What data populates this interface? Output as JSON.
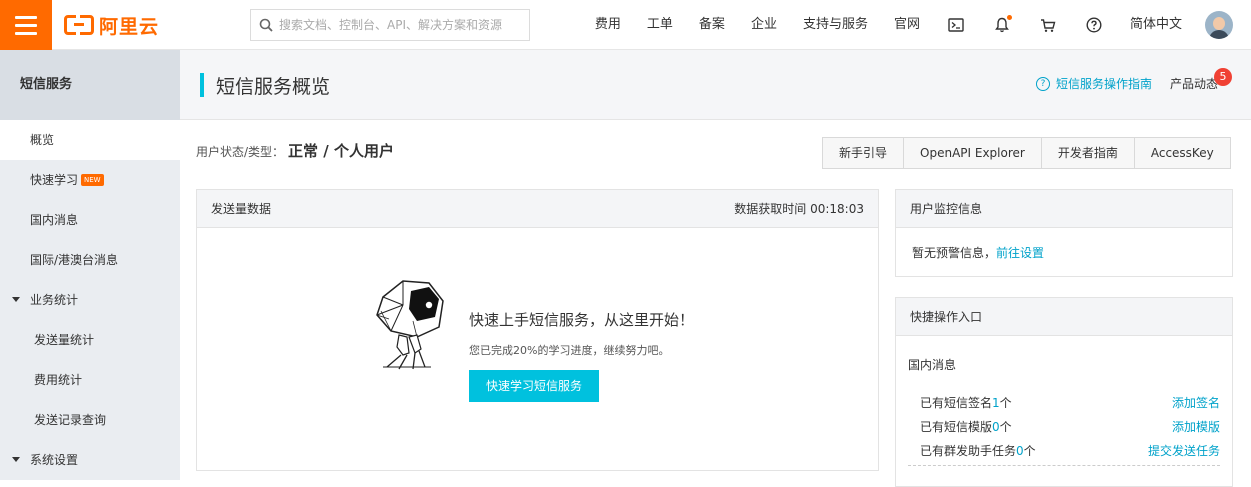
{
  "header": {
    "logo_text": "阿里云",
    "search_placeholder": "搜索文档、控制台、API、解决方案和资源",
    "nav_items": [
      "费用",
      "工单",
      "备案",
      "企业",
      "支持与服务",
      "官网"
    ],
    "language": "简体中文"
  },
  "sidebar": {
    "title": "短信服务",
    "items": {
      "overview": "概览",
      "quick_learn": "快速学习",
      "quick_learn_badge": "NEW",
      "domestic": "国内消息",
      "intl": "国际/港澳台消息",
      "stats_group": "业务统计",
      "send_stats": "发送量统计",
      "fee_stats": "费用统计",
      "send_records": "发送记录查询",
      "settings_group": "系统设置"
    }
  },
  "page": {
    "title": "短信服务概览",
    "guide_link": "短信服务操作指南",
    "dynamics": "产品动态",
    "dynamics_count": "5",
    "user_status_label": "用户状态/类型：",
    "user_status_value": "正常 / 个人用户",
    "buttons": [
      "新手引导",
      "OpenAPI Explorer",
      "开发者指南",
      "AccessKey"
    ]
  },
  "send_card": {
    "title": "发送量数据",
    "time": "数据获取时间 00:18:03",
    "empty_title": "快速上手短信服务，从这里开始！",
    "empty_desc": "您已完成20%的学习进度，继续努力吧。",
    "cta": "快速学习短信服务"
  },
  "monitor_card": {
    "title": "用户监控信息",
    "text": "暂无预警信息，",
    "link": "前往设置"
  },
  "quick_card": {
    "title": "快捷操作入口",
    "section": "国内消息",
    "rows": [
      {
        "prefix": "已有短信签名",
        "count": "1",
        "suffix": "个",
        "action": "添加签名"
      },
      {
        "prefix": "已有短信模版",
        "count": "0",
        "suffix": "个",
        "action": "添加模版"
      },
      {
        "prefix": "已有群发助手任务",
        "count": "0",
        "suffix": "个",
        "action": "提交发送任务"
      }
    ]
  },
  "colors": {
    "brand_orange": "#ff6a00",
    "accent_cyan": "#00c1de",
    "link_blue": "#00a2ca",
    "badge_red": "#f04134"
  }
}
